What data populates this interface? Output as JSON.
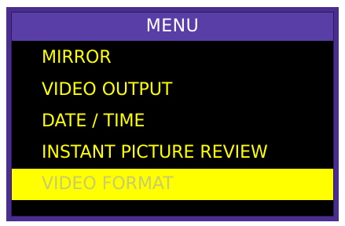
{
  "menu": {
    "title": "MENU",
    "items": [
      {
        "label": "MIRROR"
      },
      {
        "label": "VIDEO OUTPUT"
      },
      {
        "label": "DATE / TIME"
      },
      {
        "label": "INSTANT PICTURE REVIEW"
      },
      {
        "label": "VIDEO FORMAT"
      }
    ],
    "selected_label": "VIDEO FORMAT"
  },
  "colors": {
    "frame": "#4a2e8f",
    "header": "#5a3ea8",
    "background": "#000000",
    "item_text": "#ffff00",
    "selected_bg": "#ffff00",
    "selected_text": "#c8cc6a"
  }
}
